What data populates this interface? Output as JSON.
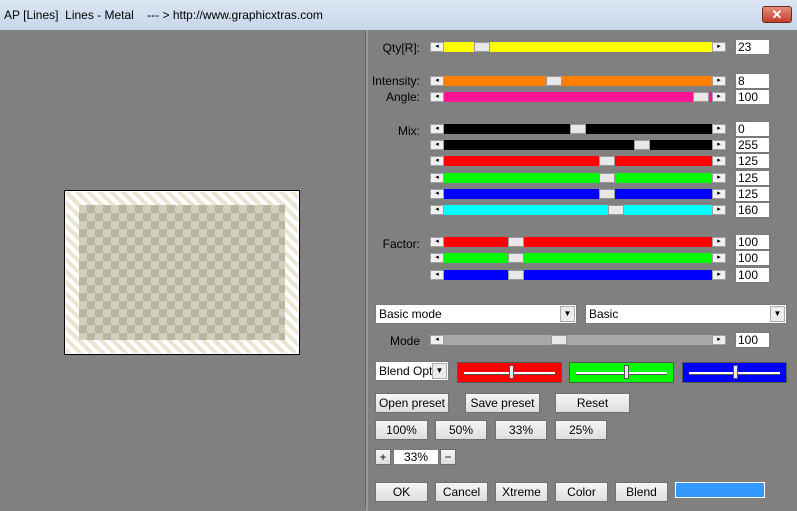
{
  "window": {
    "title": "AP [Lines]  Lines - Metal    --- > http://www.graphicxtras.com",
    "close_label": "✕"
  },
  "labels": {
    "qty": "Qty[R]:",
    "intensity": "Intensity:",
    "angle": "Angle:",
    "mix": "Mix:",
    "factor": "Factor:",
    "mode": "Mode"
  },
  "sliders": [
    {
      "id": "qty",
      "color": "#ffff00",
      "value": "23",
      "level": 0.14
    },
    {
      "id": "intensity",
      "color": "#ff8000",
      "value": "8",
      "level": 0.41
    },
    {
      "id": "angle",
      "color": "#ff1493",
      "value": "100",
      "level": 0.96
    },
    {
      "id": "mix-1",
      "color": "#000000",
      "value": "0",
      "level": 0.5
    },
    {
      "id": "mix-2",
      "color": "#000000",
      "value": "255",
      "level": 0.74
    },
    {
      "id": "mix-3",
      "color": "#ff0000",
      "value": "125",
      "level": 0.61
    },
    {
      "id": "mix-4",
      "color": "#00ff00",
      "value": "125",
      "level": 0.61
    },
    {
      "id": "mix-5",
      "color": "#0000ff",
      "value": "125",
      "level": 0.61
    },
    {
      "id": "mix-6",
      "color": "#00ffff",
      "value": "160",
      "level": 0.64
    },
    {
      "id": "factor-1",
      "color": "#ff0000",
      "value": "100",
      "level": 0.27
    },
    {
      "id": "factor-2",
      "color": "#00ff00",
      "value": "100",
      "level": 0.27
    },
    {
      "id": "factor-3",
      "color": "#0000ff",
      "value": "100",
      "level": 0.27
    },
    {
      "id": "mode",
      "color": "#a8a8a8",
      "value": "100",
      "level": 0.43
    }
  ],
  "combos": {
    "mode_select": "Basic mode",
    "basic_select": "Basic",
    "blend_options": "Blend Opti"
  },
  "color_swatches": [
    {
      "id": "red",
      "color": "#ff0000",
      "level": 0.52
    },
    {
      "id": "green",
      "color": "#00ff00",
      "level": 0.55
    },
    {
      "id": "blue",
      "color": "#0000ff",
      "level": 0.5
    }
  ],
  "buttons": {
    "open_preset": "Open preset",
    "save_preset": "Save preset",
    "reset": "Reset",
    "zoom_100": "100%",
    "zoom_50": "50%",
    "zoom_33": "33%",
    "zoom_25": "25%",
    "plus": "+",
    "minus": "−",
    "zoom_current": "33%",
    "ok": "OK",
    "cancel": "Cancel",
    "xtreme": "Xtreme",
    "color": "Color",
    "blend": "Blend"
  },
  "accent_swatch": "#3399ff"
}
